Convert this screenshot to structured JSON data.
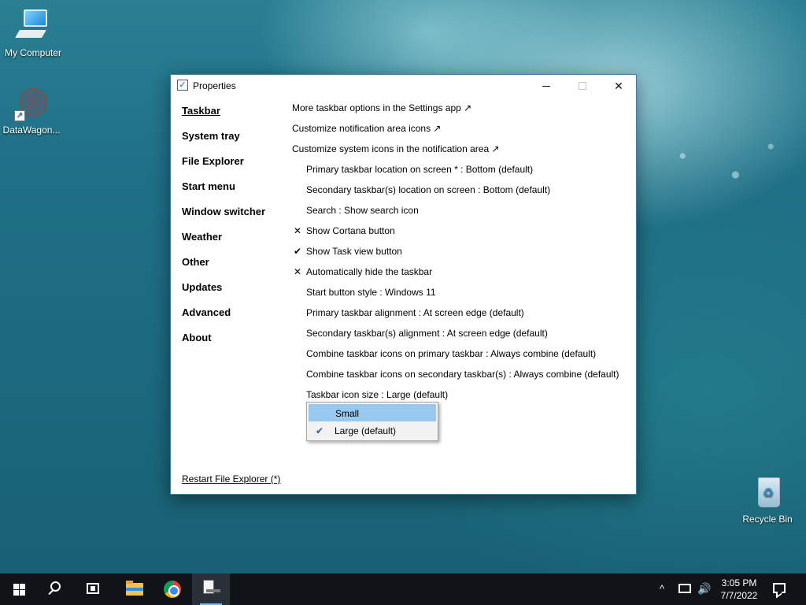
{
  "desktop": {
    "icons": [
      {
        "label": "My Computer"
      },
      {
        "label": "DataWagon..."
      },
      {
        "label": "Recycle Bin"
      }
    ]
  },
  "window": {
    "title": "Properties",
    "sidebar": [
      {
        "label": "Taskbar",
        "active": true
      },
      {
        "label": "System tray"
      },
      {
        "label": "File Explorer"
      },
      {
        "label": "Start menu"
      },
      {
        "label": "Window switcher"
      },
      {
        "label": "Weather"
      },
      {
        "label": "Other"
      },
      {
        "label": "Updates"
      },
      {
        "label": "Advanced"
      },
      {
        "label": "About"
      }
    ],
    "settings": [
      {
        "label": "More taskbar options in the Settings app ↗",
        "kind": "link"
      },
      {
        "label": "Customize notification area icons ↗",
        "kind": "link"
      },
      {
        "label": "Customize system icons in the notification area ↗",
        "kind": "link"
      },
      {
        "label": "Primary taskbar location on screen * : Bottom (default)",
        "kind": "option"
      },
      {
        "label": "Secondary taskbar(s) location on screen : Bottom (default)",
        "kind": "option"
      },
      {
        "label": "Search : Show search icon",
        "kind": "option"
      },
      {
        "label": "Show Cortana button",
        "kind": "toggle",
        "mark": "✕"
      },
      {
        "label": "Show Task view button",
        "kind": "toggle",
        "mark": "✔"
      },
      {
        "label": "Automatically hide the taskbar",
        "kind": "toggle",
        "mark": "✕"
      },
      {
        "label": "Start button style : Windows 11",
        "kind": "option"
      },
      {
        "label": "Primary taskbar alignment : At screen edge (default)",
        "kind": "option"
      },
      {
        "label": "Secondary taskbar(s) alignment : At screen edge (default)",
        "kind": "option"
      },
      {
        "label": "Combine taskbar icons on primary taskbar : Always combine (default)",
        "kind": "option"
      },
      {
        "label": "Combine taskbar icons on secondary taskbar(s) : Always combine (default)",
        "kind": "option"
      },
      {
        "label": "Taskbar icon size : Large (default)",
        "kind": "option"
      }
    ],
    "dropdown": {
      "options": [
        {
          "label": "Small",
          "highlighted": true,
          "checked": false
        },
        {
          "label": "Large (default)",
          "highlighted": false,
          "checked": true
        }
      ]
    },
    "restart_link": "Restart File Explorer (*)"
  },
  "taskbar": {
    "clock_time": "3:05 PM",
    "clock_date": "7/7/2022",
    "tray_chevron": "^",
    "volume": "🔊"
  },
  "icons": {
    "check": "✔",
    "close": "✕"
  }
}
